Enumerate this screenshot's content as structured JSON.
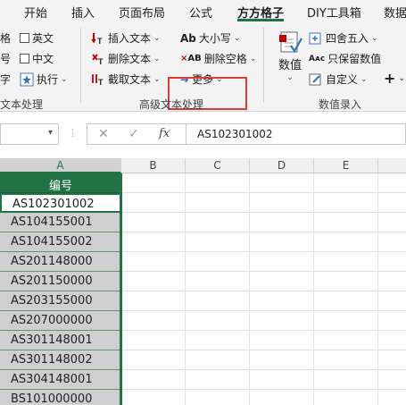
{
  "menu_tabs": [
    {
      "label": "开始"
    },
    {
      "label": "插入"
    },
    {
      "label": "页面布局"
    },
    {
      "label": "公式"
    },
    {
      "label": "方方格子"
    },
    {
      "label": "DIY工具箱"
    },
    {
      "label": "数据"
    }
  ],
  "ribbon": {
    "group_text": {
      "items": [
        {
          "label": "格"
        },
        {
          "label": "号"
        },
        {
          "label": "字"
        }
      ],
      "checkboxes": [
        {
          "label": "英文"
        },
        {
          "label": "中文"
        }
      ],
      "execute_label": "执行",
      "group_label": "文本处理"
    },
    "group_advanced": {
      "insert_text": "插入文本",
      "delete_text": "删除文本",
      "extract_text": "截取文本",
      "case": "大小写",
      "delete_space": "删除空格",
      "more": "更多",
      "group_label": "高级文本处理"
    },
    "group_number": {
      "number_label": "数值",
      "round": "四舍五入",
      "keep_value": "只保留数值",
      "custom": "自定义",
      "plus": "+",
      "group_label": "数值录入"
    }
  },
  "formula_bar": {
    "name_box": "",
    "fx": "fx",
    "value": "AS102301002"
  },
  "columns": [
    "A",
    "B",
    "C",
    "D",
    "E"
  ],
  "column_a": {
    "header": "编号",
    "values": [
      "AS102301002",
      "AS104155001",
      "AS104155002",
      "AS201148000",
      "AS201150000",
      "AS203155000",
      "AS207000000",
      "AS301148001",
      "AS301148002",
      "AS304148001",
      "BS101000000"
    ]
  }
}
